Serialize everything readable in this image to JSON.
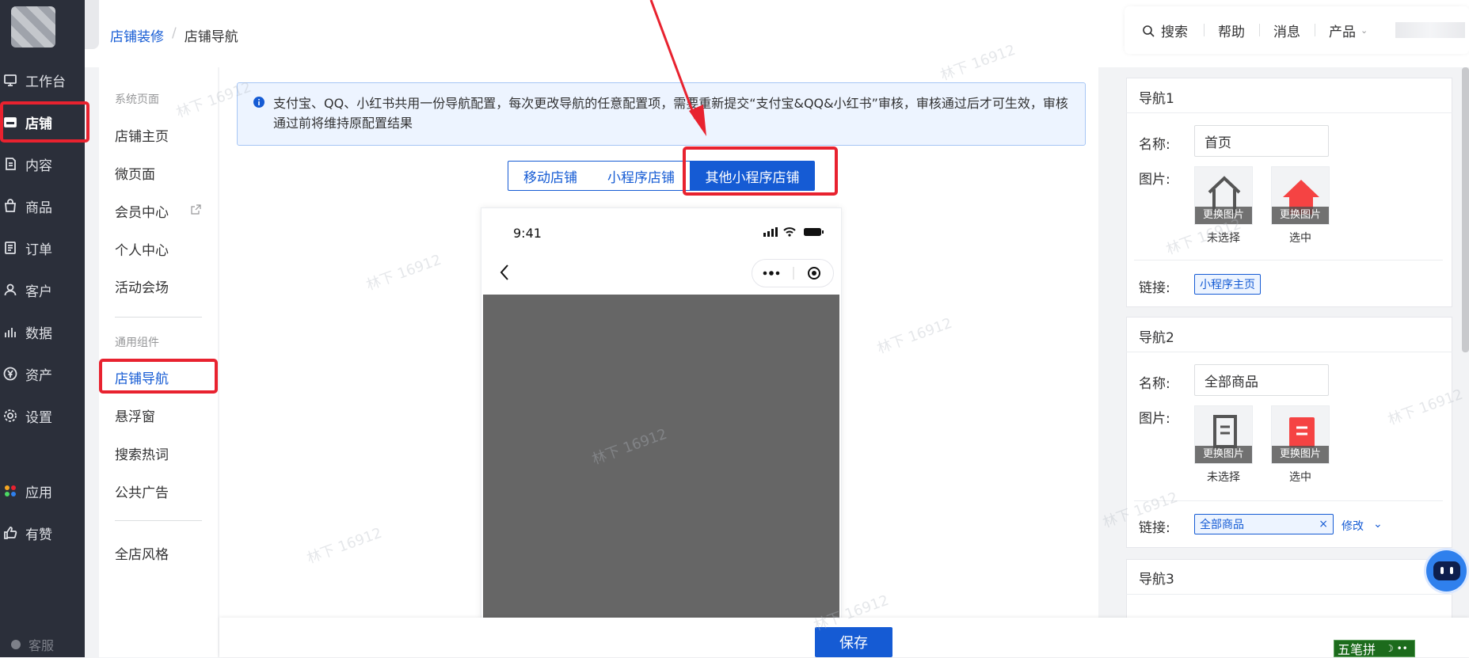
{
  "sidebar": {
    "items": [
      {
        "label": "工作台",
        "icon": "dashboard-icon"
      },
      {
        "label": "店铺",
        "icon": "store-icon"
      },
      {
        "label": "内容",
        "icon": "content-icon"
      },
      {
        "label": "商品",
        "icon": "bag-icon"
      },
      {
        "label": "订单",
        "icon": "order-icon"
      },
      {
        "label": "客户",
        "icon": "user-icon"
      },
      {
        "label": "数据",
        "icon": "chart-icon"
      },
      {
        "label": "资产",
        "icon": "yen-icon"
      },
      {
        "label": "设置",
        "icon": "gear-icon"
      },
      {
        "label": "应用",
        "icon": "apps-icon"
      },
      {
        "label": "有赞",
        "icon": "thumb-icon"
      }
    ],
    "service_label": "客服"
  },
  "submenu": {
    "group1": "系统页面",
    "group1_items": [
      "店铺主页",
      "微页面",
      "会员中心",
      "个人中心",
      "活动会场"
    ],
    "group2": "通用组件",
    "group2_items": [
      "店铺导航",
      "悬浮窗",
      "搜索热词",
      "公共广告"
    ],
    "bottom_item": "全店风格"
  },
  "breadcrumb": {
    "parent": "店铺装修",
    "separator": "/",
    "current": "店铺导航"
  },
  "toolbar": {
    "search": "搜索",
    "help": "帮助",
    "messages": "消息",
    "products": "产品"
  },
  "notice": "支付宝、QQ、小红书共用一份导航配置，每次更改导航的任意配置项，需要重新提交“支付宝&QQ&小红书”审核，审核通过后才可生效，审核通过前将维持原配置结果",
  "tabs": [
    "移动店铺",
    "小程序店铺",
    "其他小程序店铺"
  ],
  "phone": {
    "time": "9:41"
  },
  "nav_configs": [
    {
      "title": "导航1",
      "name_label": "名称:",
      "name": "首页",
      "image_label": "图片:",
      "replace": "更换图片",
      "unselected": "未选择",
      "selected": "选中",
      "link_label": "链接:",
      "link": "小程序主页"
    },
    {
      "title": "导航2",
      "name_label": "名称:",
      "name": "全部商品",
      "image_label": "图片:",
      "replace": "更换图片",
      "unselected": "未选择",
      "selected": "选中",
      "link_label": "链接:",
      "link": "全部商品",
      "modify": "修改"
    },
    {
      "title": "导航3"
    }
  ],
  "save_label": "保存",
  "ime_label": "五笔拼",
  "watermark": "林下 16912",
  "colors": {
    "primary": "#155bd4",
    "sidebar": "#2b2f3a",
    "highlight": "#e8222f"
  }
}
